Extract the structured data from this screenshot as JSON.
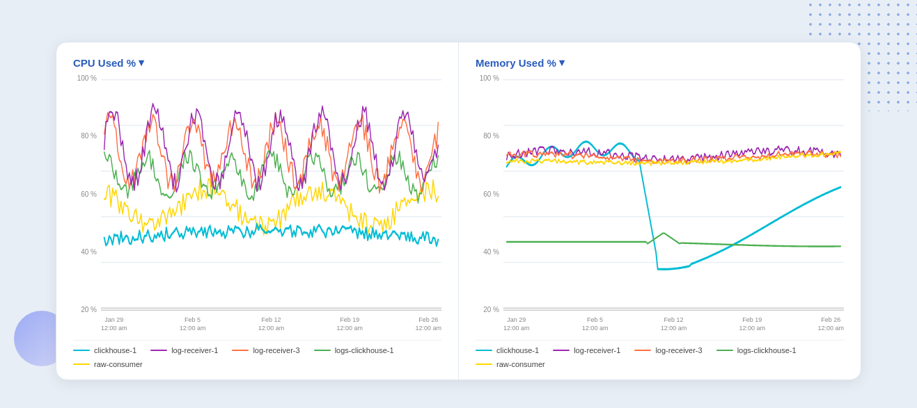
{
  "decoration": {
    "dot_pattern": "dots",
    "blob": "gradient-circle"
  },
  "cpu_chart": {
    "title": "CPU Used %",
    "title_chevron": "▾",
    "y_labels": [
      "100 %",
      "80 %",
      "60 %",
      "40 %",
      "20 %"
    ],
    "x_labels": [
      {
        "line1": "Jan 29",
        "line2": "12:00 am"
      },
      {
        "line1": "Feb 5",
        "line2": "12:00 am"
      },
      {
        "line1": "Feb 12",
        "line2": "12:00 am"
      },
      {
        "line1": "Feb 19",
        "line2": "12:00 am"
      },
      {
        "line1": "Feb 26",
        "line2": "12:00 am"
      }
    ]
  },
  "memory_chart": {
    "title": "Memory Used %",
    "title_chevron": "▾",
    "y_labels": [
      "100 %",
      "80 %",
      "60 %",
      "40 %",
      "20 %"
    ],
    "x_labels": [
      {
        "line1": "Jan 29",
        "line2": "12:00 am"
      },
      {
        "line1": "Feb 5",
        "line2": "12:00 am"
      },
      {
        "line1": "Feb 12",
        "line2": "12:00 am"
      },
      {
        "line1": "Feb 19",
        "line2": "12:00 am"
      },
      {
        "line1": "Feb 26",
        "line2": "12:00 am"
      }
    ]
  },
  "legend": {
    "items": [
      {
        "label": "clickhouse-1",
        "color": "#00bcd4"
      },
      {
        "label": "log-receiver-1",
        "color": "#9c27b0"
      },
      {
        "label": "log-receiver-3",
        "color": "#ff7043"
      },
      {
        "label": "logs-clickhouse-1",
        "color": "#4caf50"
      },
      {
        "label": "raw-consumer",
        "color": "#ffd600"
      }
    ]
  },
  "colors": {
    "cyan": "#00bcd4",
    "purple": "#9c27b0",
    "orange": "#ff7043",
    "green": "#4caf50",
    "yellow": "#ffd600",
    "red": "#ef5350"
  }
}
